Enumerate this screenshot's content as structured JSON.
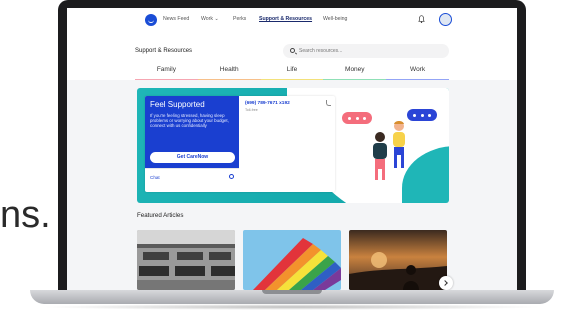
{
  "background_text": "ns.",
  "nav": {
    "links": [
      "News Feed",
      "Work",
      "Perks",
      "Support & Resources",
      "Well-being"
    ],
    "active": "Support & Resources"
  },
  "header": {
    "title": "Support & Resources",
    "search_placeholder": "Search resources..."
  },
  "tabs": [
    {
      "label": "Family",
      "color": "#f6a6b2"
    },
    {
      "label": "Health",
      "color": "#f7c08a"
    },
    {
      "label": "Life",
      "color": "#f3e17a"
    },
    {
      "label": "Money",
      "color": "#8fe0b6"
    },
    {
      "label": "Work",
      "color": "#93a4f6"
    }
  ],
  "hero": {
    "title": "Feel Supported",
    "body": "If you're feeling stressed, having sleep problems or worrying about your budget, connect with us confidentially",
    "button": "Get CareNow",
    "chat_label": "Chat",
    "phone": "(699) 789-7671 x192",
    "phone_sub": "Toll-free"
  },
  "featured": {
    "title": "Featured Articles"
  },
  "colors": {
    "brand": "#1a3fd0",
    "teal": "#1fb6b7",
    "bubble_pink": "#f46d7c",
    "bubble_blue": "#2b45d6"
  },
  "icons": [
    "logo-icon",
    "chevron-down-icon",
    "bell-icon",
    "avatar",
    "search-icon",
    "phone-icon",
    "chat-icon",
    "chevron-right-icon"
  ]
}
